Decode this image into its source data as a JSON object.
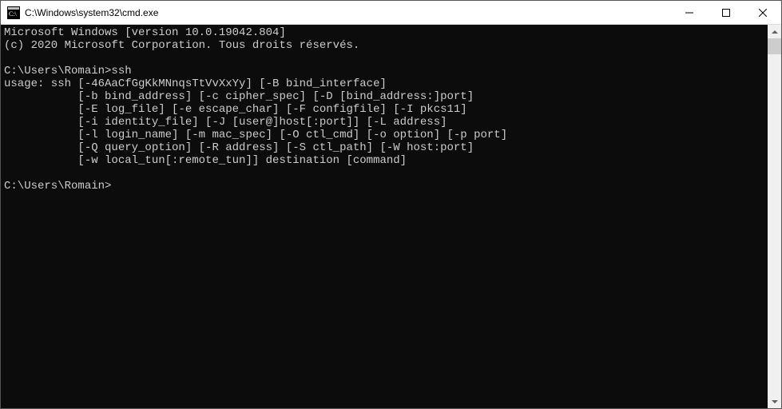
{
  "window": {
    "title": "C:\\Windows\\system32\\cmd.exe"
  },
  "console": {
    "lines": [
      "Microsoft Windows [version 10.0.19042.804]",
      "(c) 2020 Microsoft Corporation. Tous droits réservés.",
      "",
      "C:\\Users\\Romain>ssh",
      "usage: ssh [-46AaCfGgKkMNnqsTtVvXxYy] [-B bind_interface]",
      "           [-b bind_address] [-c cipher_spec] [-D [bind_address:]port]",
      "           [-E log_file] [-e escape_char] [-F configfile] [-I pkcs11]",
      "           [-i identity_file] [-J [user@]host[:port]] [-L address]",
      "           [-l login_name] [-m mac_spec] [-O ctl_cmd] [-o option] [-p port]",
      "           [-Q query_option] [-R address] [-S ctl_path] [-W host:port]",
      "           [-w local_tun[:remote_tun]] destination [command]",
      "",
      "C:\\Users\\Romain>"
    ]
  }
}
